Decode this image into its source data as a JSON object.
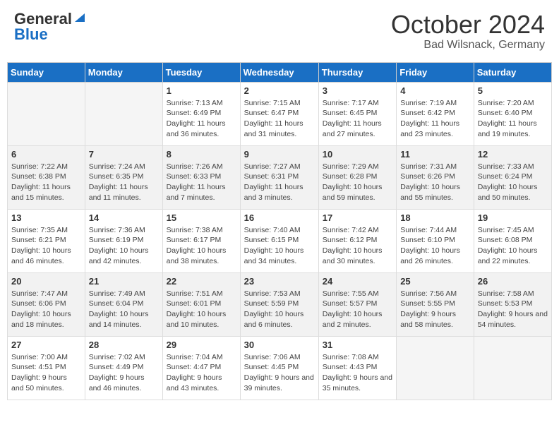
{
  "header": {
    "logo_general": "General",
    "logo_blue": "Blue",
    "month_title": "October 2024",
    "location": "Bad Wilsnack, Germany"
  },
  "days_of_week": [
    "Sunday",
    "Monday",
    "Tuesday",
    "Wednesday",
    "Thursday",
    "Friday",
    "Saturday"
  ],
  "weeks": [
    [
      {
        "num": "",
        "info": ""
      },
      {
        "num": "",
        "info": ""
      },
      {
        "num": "1",
        "info": "Sunrise: 7:13 AM\nSunset: 6:49 PM\nDaylight: 11 hours and 36 minutes."
      },
      {
        "num": "2",
        "info": "Sunrise: 7:15 AM\nSunset: 6:47 PM\nDaylight: 11 hours and 31 minutes."
      },
      {
        "num": "3",
        "info": "Sunrise: 7:17 AM\nSunset: 6:45 PM\nDaylight: 11 hours and 27 minutes."
      },
      {
        "num": "4",
        "info": "Sunrise: 7:19 AM\nSunset: 6:42 PM\nDaylight: 11 hours and 23 minutes."
      },
      {
        "num": "5",
        "info": "Sunrise: 7:20 AM\nSunset: 6:40 PM\nDaylight: 11 hours and 19 minutes."
      }
    ],
    [
      {
        "num": "6",
        "info": "Sunrise: 7:22 AM\nSunset: 6:38 PM\nDaylight: 11 hours and 15 minutes."
      },
      {
        "num": "7",
        "info": "Sunrise: 7:24 AM\nSunset: 6:35 PM\nDaylight: 11 hours and 11 minutes."
      },
      {
        "num": "8",
        "info": "Sunrise: 7:26 AM\nSunset: 6:33 PM\nDaylight: 11 hours and 7 minutes."
      },
      {
        "num": "9",
        "info": "Sunrise: 7:27 AM\nSunset: 6:31 PM\nDaylight: 11 hours and 3 minutes."
      },
      {
        "num": "10",
        "info": "Sunrise: 7:29 AM\nSunset: 6:28 PM\nDaylight: 10 hours and 59 minutes."
      },
      {
        "num": "11",
        "info": "Sunrise: 7:31 AM\nSunset: 6:26 PM\nDaylight: 10 hours and 55 minutes."
      },
      {
        "num": "12",
        "info": "Sunrise: 7:33 AM\nSunset: 6:24 PM\nDaylight: 10 hours and 50 minutes."
      }
    ],
    [
      {
        "num": "13",
        "info": "Sunrise: 7:35 AM\nSunset: 6:21 PM\nDaylight: 10 hours and 46 minutes."
      },
      {
        "num": "14",
        "info": "Sunrise: 7:36 AM\nSunset: 6:19 PM\nDaylight: 10 hours and 42 minutes."
      },
      {
        "num": "15",
        "info": "Sunrise: 7:38 AM\nSunset: 6:17 PM\nDaylight: 10 hours and 38 minutes."
      },
      {
        "num": "16",
        "info": "Sunrise: 7:40 AM\nSunset: 6:15 PM\nDaylight: 10 hours and 34 minutes."
      },
      {
        "num": "17",
        "info": "Sunrise: 7:42 AM\nSunset: 6:12 PM\nDaylight: 10 hours and 30 minutes."
      },
      {
        "num": "18",
        "info": "Sunrise: 7:44 AM\nSunset: 6:10 PM\nDaylight: 10 hours and 26 minutes."
      },
      {
        "num": "19",
        "info": "Sunrise: 7:45 AM\nSunset: 6:08 PM\nDaylight: 10 hours and 22 minutes."
      }
    ],
    [
      {
        "num": "20",
        "info": "Sunrise: 7:47 AM\nSunset: 6:06 PM\nDaylight: 10 hours and 18 minutes."
      },
      {
        "num": "21",
        "info": "Sunrise: 7:49 AM\nSunset: 6:04 PM\nDaylight: 10 hours and 14 minutes."
      },
      {
        "num": "22",
        "info": "Sunrise: 7:51 AM\nSunset: 6:01 PM\nDaylight: 10 hours and 10 minutes."
      },
      {
        "num": "23",
        "info": "Sunrise: 7:53 AM\nSunset: 5:59 PM\nDaylight: 10 hours and 6 minutes."
      },
      {
        "num": "24",
        "info": "Sunrise: 7:55 AM\nSunset: 5:57 PM\nDaylight: 10 hours and 2 minutes."
      },
      {
        "num": "25",
        "info": "Sunrise: 7:56 AM\nSunset: 5:55 PM\nDaylight: 9 hours and 58 minutes."
      },
      {
        "num": "26",
        "info": "Sunrise: 7:58 AM\nSunset: 5:53 PM\nDaylight: 9 hours and 54 minutes."
      }
    ],
    [
      {
        "num": "27",
        "info": "Sunrise: 7:00 AM\nSunset: 4:51 PM\nDaylight: 9 hours and 50 minutes."
      },
      {
        "num": "28",
        "info": "Sunrise: 7:02 AM\nSunset: 4:49 PM\nDaylight: 9 hours and 46 minutes."
      },
      {
        "num": "29",
        "info": "Sunrise: 7:04 AM\nSunset: 4:47 PM\nDaylight: 9 hours and 43 minutes."
      },
      {
        "num": "30",
        "info": "Sunrise: 7:06 AM\nSunset: 4:45 PM\nDaylight: 9 hours and 39 minutes."
      },
      {
        "num": "31",
        "info": "Sunrise: 7:08 AM\nSunset: 4:43 PM\nDaylight: 9 hours and 35 minutes."
      },
      {
        "num": "",
        "info": ""
      },
      {
        "num": "",
        "info": ""
      }
    ]
  ]
}
